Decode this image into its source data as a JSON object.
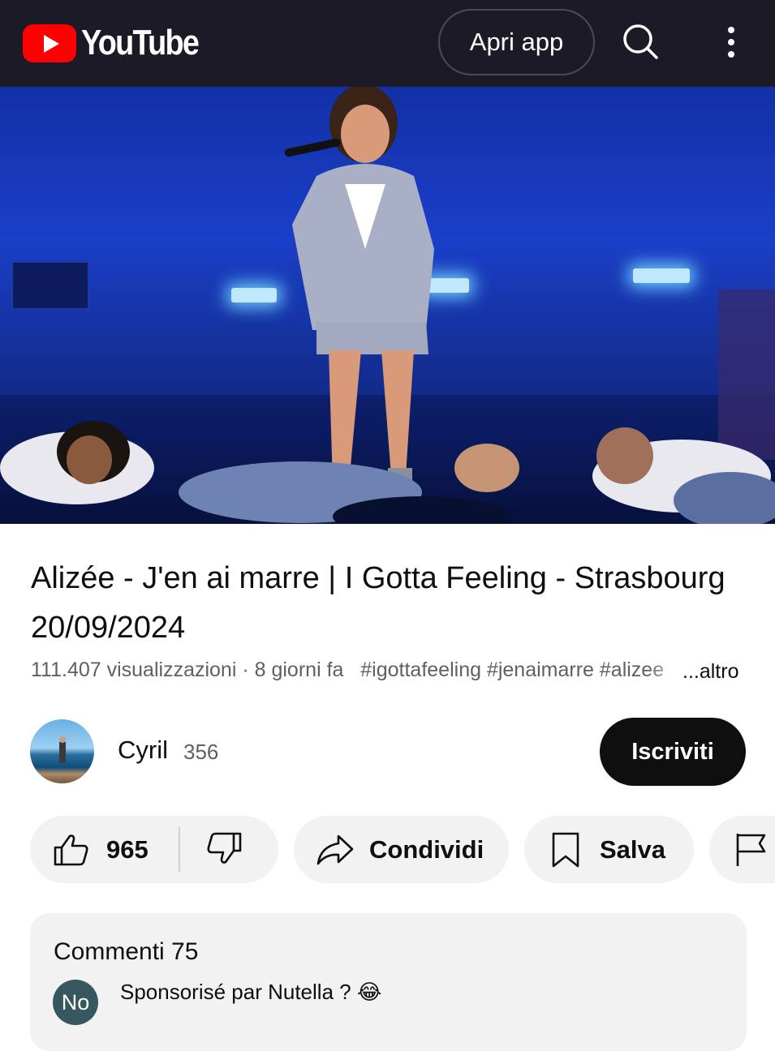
{
  "header": {
    "logo_text": "YouTube",
    "open_app_label": "Apri app",
    "icons": [
      "youtube-logo-icon",
      "search-icon",
      "more-vert-icon"
    ]
  },
  "video": {
    "title": "Alizée - J'en ai marre | I Gotta Feeling - Strasbourg 20/09/2024",
    "views": "111.407 visualizzazioni",
    "separator": " · ",
    "age": "8 giorni fa",
    "hashtags": "#igottafeeling #jenaimarre #alizee",
    "more_label": "...altro"
  },
  "channel": {
    "name": "Cyril",
    "subscribers": "356",
    "subscribe_label": "Iscriviti"
  },
  "actions": {
    "likes": "965",
    "share_label": "Condividi",
    "save_label": "Salva"
  },
  "comments": {
    "header": "Commenti 75",
    "top_comment": {
      "avatar_initials": "No",
      "text": "Sponsorisé par Nutella ? 😂"
    }
  },
  "colors": {
    "topbar": "#1b1a26",
    "brand_red": "#ff0000",
    "pill_bg": "#f2f2f2",
    "subscribe_bg": "#0f0f0f"
  }
}
